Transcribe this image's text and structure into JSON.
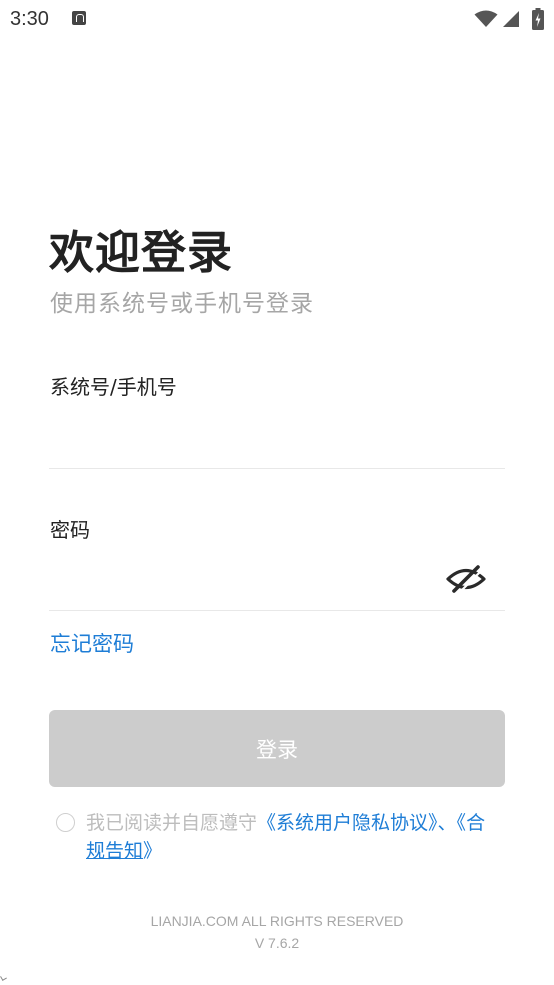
{
  "status_bar": {
    "time": "3:30",
    "icons": [
      "notification-icon",
      "wifi-icon",
      "signal-icon",
      "battery-icon"
    ]
  },
  "header": {
    "title": "欢迎登录",
    "subtitle": "使用系统号或手机号登录"
  },
  "form": {
    "account": {
      "label": "系统号/手机号",
      "value": "",
      "placeholder": ""
    },
    "password": {
      "label": "密码",
      "value": "",
      "placeholder": "",
      "toggle_icon": "eye-off-icon"
    },
    "forgot_password": "忘记密码",
    "submit_label": "登录"
  },
  "agreement": {
    "prefix": "我已阅读并自愿遵守",
    "privacy_link": "《系统用户隐私协议》",
    "separator": "、",
    "compliance_link_open": "《",
    "compliance_link_part1": "合",
    "compliance_link_part2": "规告知",
    "compliance_link_close": "》",
    "checked": false
  },
  "footer": {
    "copyright": "LIANJIA.COM ALL RIGHTS RESERVED",
    "version": "V 7.6.2"
  },
  "colors": {
    "accent": "#1e7dd6",
    "button_disabled": "#cccccc",
    "subtitle": "#a6a6a6",
    "divider": "#e8e8e8"
  }
}
